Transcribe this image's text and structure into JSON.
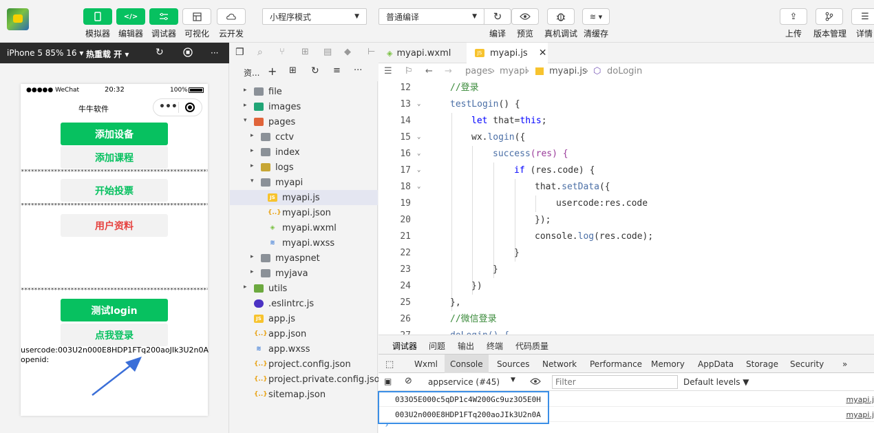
{
  "toolbar": {
    "simulator": "模拟器",
    "editor": "编辑器",
    "debugger": "调试器",
    "visual": "可视化",
    "cloud": "云开发",
    "mode": "小程序模式",
    "compile_mode": "普通编译",
    "compile": "编译",
    "preview": "预览",
    "remote_debug": "真机调试",
    "clear_cache": "清缓存",
    "upload": "上传",
    "version": "版本管理",
    "details": "详情"
  },
  "simulator": {
    "device": "iPhone 5 85% 16 ▾",
    "hot_reload": "热重载 开 ▾",
    "more": "···",
    "status_carrier": "●●●●● WeChat",
    "status_time": "20:32",
    "status_battery": "100%",
    "nav_title": "牛牛软件",
    "capsule_dots": "•••",
    "btn_add_device": "添加设备",
    "btn_add_course": "添加课程",
    "stars": "**********************************************************",
    "btn_vote": "开始投票",
    "btn_profile": "用户资料",
    "btn_test_login": "测试login",
    "btn_login": "点我登录",
    "usercode": "usercode:003U2n000E8HDP1FTq200aoJIk3U2n0A",
    "openid": "openid:"
  },
  "explorer": {
    "title": "资...",
    "tree": [
      {
        "name": "file",
        "type": "folder",
        "depth": 0,
        "twisty": "▸"
      },
      {
        "name": "images",
        "type": "folder-img",
        "depth": 0,
        "twisty": "▸"
      },
      {
        "name": "pages",
        "type": "folder-pg",
        "depth": 0,
        "twisty": "▾"
      },
      {
        "name": "cctv",
        "type": "folder",
        "depth": 1,
        "twisty": "▸"
      },
      {
        "name": "index",
        "type": "folder",
        "depth": 1,
        "twisty": "▸"
      },
      {
        "name": "logs",
        "type": "folder-logs",
        "depth": 1,
        "twisty": "▸"
      },
      {
        "name": "myapi",
        "type": "folder",
        "depth": 1,
        "twisty": "▾"
      },
      {
        "name": "myapi.js",
        "type": "js",
        "depth": 2,
        "twisty": ""
      },
      {
        "name": "myapi.json",
        "type": "json",
        "depth": 2,
        "twisty": ""
      },
      {
        "name": "myapi.wxml",
        "type": "wxml",
        "depth": 2,
        "twisty": ""
      },
      {
        "name": "myapi.wxss",
        "type": "wxss",
        "depth": 2,
        "twisty": ""
      },
      {
        "name": "myaspnet",
        "type": "folder",
        "depth": 1,
        "twisty": "▸"
      },
      {
        "name": "myjava",
        "type": "folder",
        "depth": 1,
        "twisty": "▸"
      },
      {
        "name": "utils",
        "type": "folder-utils",
        "depth": 0,
        "twisty": "▸"
      },
      {
        "name": ".eslintrc.js",
        "type": "eslint",
        "depth": 0,
        "twisty": ""
      },
      {
        "name": "app.js",
        "type": "js",
        "depth": 0,
        "twisty": ""
      },
      {
        "name": "app.json",
        "type": "json",
        "depth": 0,
        "twisty": ""
      },
      {
        "name": "app.wxss",
        "type": "wxss",
        "depth": 0,
        "twisty": ""
      },
      {
        "name": "project.config.json",
        "type": "json",
        "depth": 0,
        "twisty": ""
      },
      {
        "name": "project.private.config.json",
        "type": "json",
        "depth": 0,
        "twisty": ""
      },
      {
        "name": "sitemap.json",
        "type": "json",
        "depth": 0,
        "twisty": ""
      }
    ]
  },
  "editor": {
    "tab1": "myapi.wxml",
    "tab2": "myapi.js",
    "crumb_pages": "pages",
    "crumb_myapi": "myapi",
    "crumb_file": "myapi.js",
    "crumb_fn": "doLogin",
    "lines": [
      {
        "n": "12",
        "fold": ""
      },
      {
        "n": "13",
        "fold": "⌄"
      },
      {
        "n": "14",
        "fold": ""
      },
      {
        "n": "15",
        "fold": "⌄"
      },
      {
        "n": "16",
        "fold": "⌄"
      },
      {
        "n": "17",
        "fold": "⌄"
      },
      {
        "n": "18",
        "fold": "⌄"
      },
      {
        "n": "19",
        "fold": ""
      },
      {
        "n": "20",
        "fold": ""
      },
      {
        "n": "21",
        "fold": ""
      },
      {
        "n": "22",
        "fold": ""
      },
      {
        "n": "23",
        "fold": ""
      },
      {
        "n": "24",
        "fold": ""
      },
      {
        "n": "25",
        "fold": ""
      },
      {
        "n": "26",
        "fold": ""
      },
      {
        "n": "27",
        "fold": ""
      }
    ],
    "code": {
      "l12": "//登录",
      "l13_fn": "testLogin",
      "l13_rest": "() {",
      "l14_kw": "let",
      "l14_rest": " that=",
      "l14_this": "this",
      "l14_end": ";",
      "l15_obj": "wx.",
      "l15_fn": "login",
      "l15_rest": "({",
      "l16_fn": "success",
      "l16_p": "(res) {",
      "l17_kw": "if",
      "l17_rest": " (res.code) {",
      "l18_obj": "that.",
      "l18_fn": "setData",
      "l18_rest": "({",
      "l19": "usercode:res.code",
      "l20": "});",
      "l21_obj": "console.",
      "l21_fn": "log",
      "l21_rest": "(res.code);",
      "l22": "}",
      "l23": "}",
      "l24": "})",
      "l25": "},",
      "l26": "//微信登录",
      "l27": "doLogin() {"
    }
  },
  "debug": {
    "tabs": [
      "调试器",
      "问题",
      "输出",
      "终端",
      "代码质量"
    ],
    "devtools_tabs": [
      "Wxml",
      "Console",
      "Sources",
      "Network",
      "Performance",
      "Memory",
      "AppData",
      "Storage",
      "Security",
      "»"
    ],
    "context": "appservice (#45)",
    "filter_placeholder": "Filter",
    "levels": "Default levels ▼",
    "logs": [
      {
        "msg": "033O5E000c5qDP1c4W200Gc9uz3O5E0H",
        "src": "myapi.j"
      },
      {
        "msg": "003U2n000E8HDP1FTq200aoJIk3U2n0A",
        "src": "myapi.j"
      }
    ],
    "prompt": "›"
  },
  "colors": {
    "wechat_green": "#07c160",
    "highlight_blue": "#3a8ee6",
    "arrow_blue": "#3b6fd8",
    "profile_red": "#e64340"
  }
}
